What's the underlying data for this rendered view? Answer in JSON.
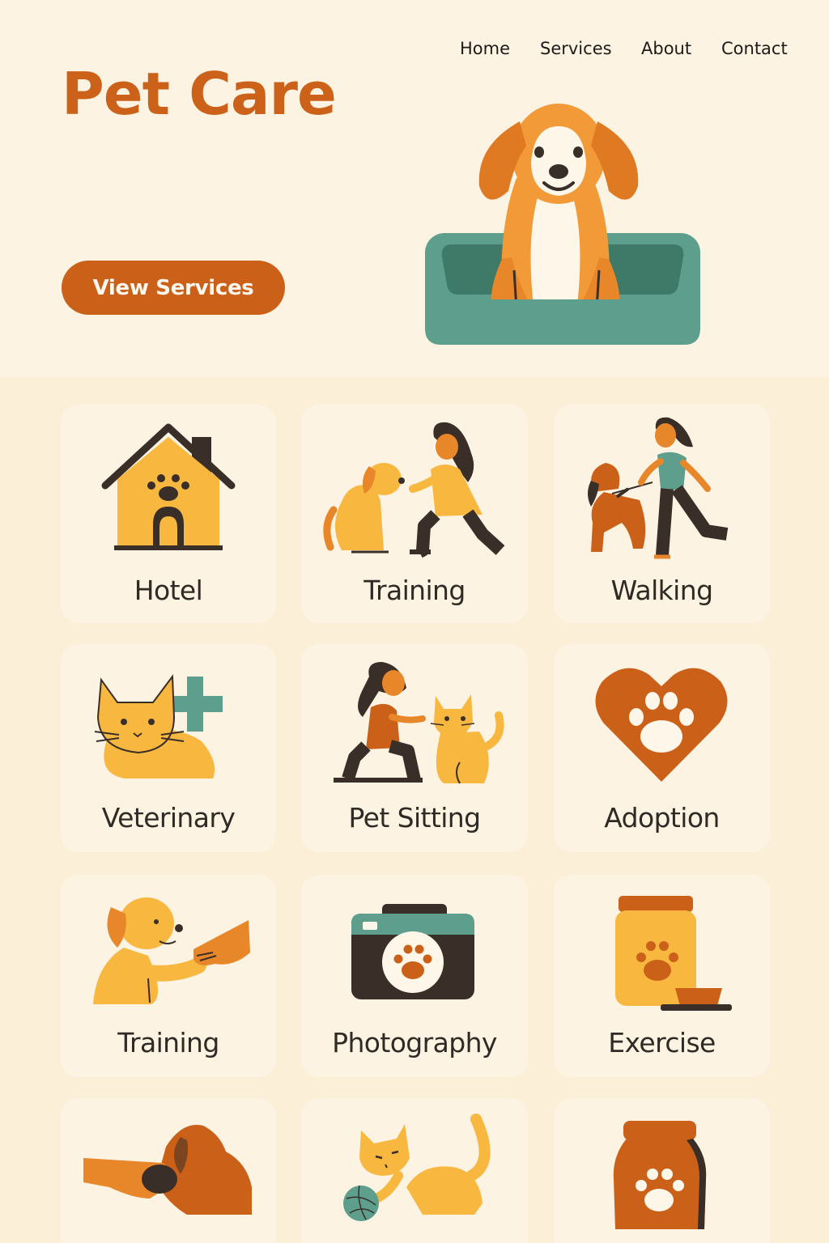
{
  "header": {
    "title": "Pet Care",
    "nav": [
      "Home",
      "Services",
      "About",
      "Contact"
    ],
    "cta_label": "View Services"
  },
  "services": [
    {
      "label": "Hotel",
      "icon": "dog-house-icon"
    },
    {
      "label": "Training",
      "icon": "woman-training-dog-icon"
    },
    {
      "label": "Walking",
      "icon": "woman-walking-dog-icon"
    },
    {
      "label": "Veterinary",
      "icon": "cat-medical-cross-icon"
    },
    {
      "label": "Pet Sitting",
      "icon": "woman-petting-cat-icon"
    },
    {
      "label": "Adoption",
      "icon": "paw-heart-icon"
    },
    {
      "label": "Training",
      "icon": "dog-hand-shake-icon"
    },
    {
      "label": "Photography",
      "icon": "paw-camera-icon"
    },
    {
      "label": "Exercise",
      "icon": "food-jar-bowl-icon"
    },
    {
      "label": "",
      "icon": "hand-feeding-dog-icon"
    },
    {
      "label": "",
      "icon": "cat-with-yarn-icon"
    },
    {
      "label": "",
      "icon": "pet-food-bag-icon"
    }
  ],
  "colors": {
    "accent": "#cb6119",
    "orange": "#e8862a",
    "yellow": "#f8b73f",
    "teal": "#5d9e8c",
    "dark": "#3a2f28",
    "card_bg": "#fdf3e2",
    "page_bg": "#fcefd8"
  }
}
